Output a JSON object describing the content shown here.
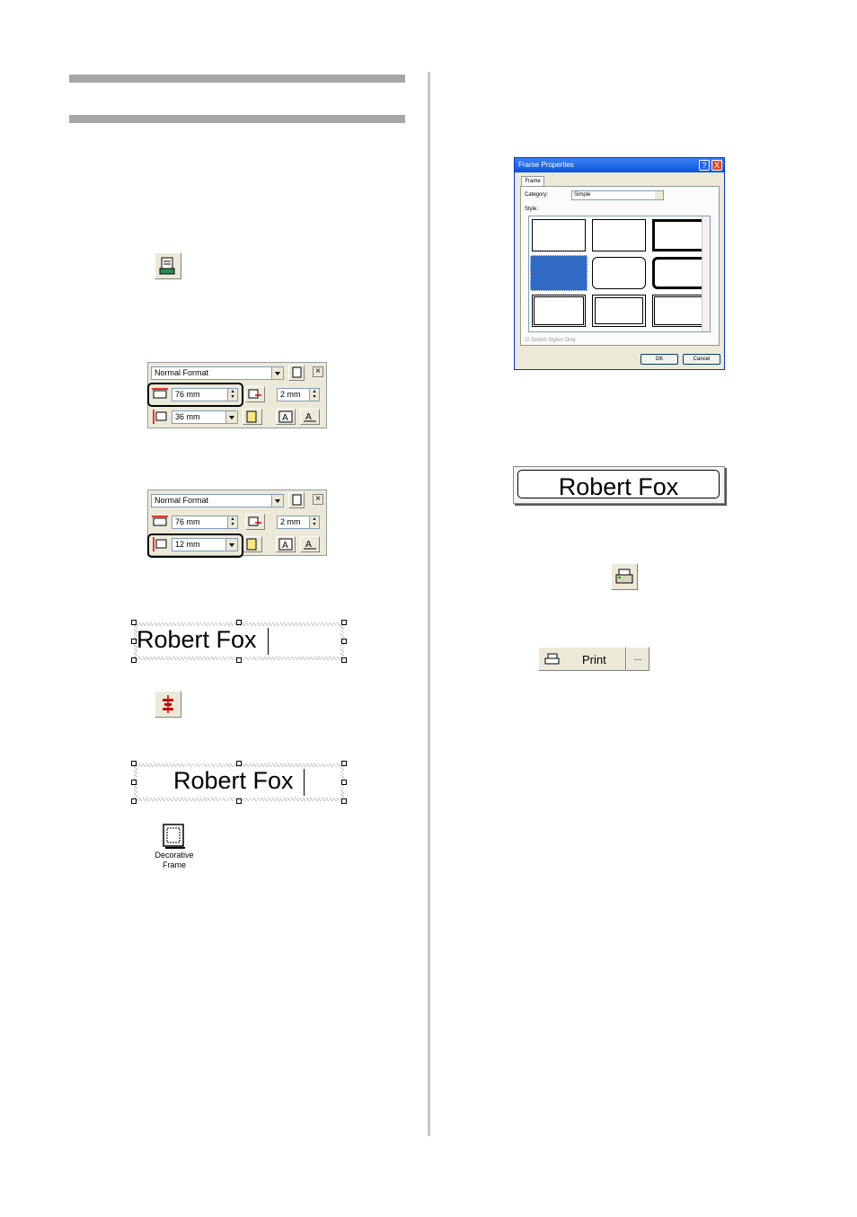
{
  "toolbar1": {
    "format": "Normal Format",
    "length": "76 mm",
    "margin": "2 mm",
    "width": "36 mm"
  },
  "toolbar2": {
    "format": "Normal Format",
    "length": "76 mm",
    "margin": "2 mm",
    "width": "12 mm"
  },
  "text_object": {
    "text": "Robert Fox"
  },
  "text_object_centered": {
    "text": "Robert Fox"
  },
  "decorative_frame": {
    "label_line1": "Decorative",
    "label_line2": "Frame"
  },
  "dialog": {
    "title": "Frame Properties",
    "tab": "Frame",
    "category_label": "Category:",
    "category_value": "Simple",
    "style_label": "Style:",
    "checkbox_label": "Switch Styles Only",
    "ok": "OK",
    "cancel": "Cancel",
    "help": "?",
    "close": "X"
  },
  "preview": {
    "text": "Robert Fox"
  },
  "print_button": {
    "label": "Print",
    "more": "..."
  }
}
